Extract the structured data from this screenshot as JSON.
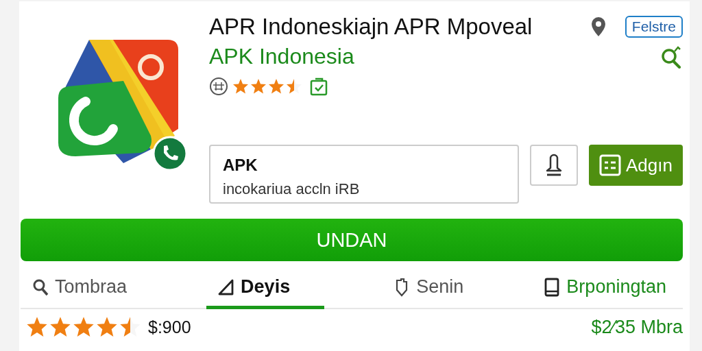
{
  "app": {
    "title": "APR Indoneskiajn APR Mpoveal",
    "developer": "APK Indonesia",
    "stars": 3.5,
    "badge": "Felstre"
  },
  "search": {
    "label": "APK",
    "value": "incokariua accln iRB"
  },
  "action_button": "Adgın",
  "install_button": "UNDAN",
  "tabs": [
    {
      "label": "Tombraa",
      "kind": "search",
      "selected": false,
      "highlighted": false
    },
    {
      "label": "Deyis",
      "kind": "triangle",
      "selected": true,
      "highlighted": false
    },
    {
      "label": "Senin",
      "kind": "tag",
      "selected": false,
      "highlighted": false
    },
    {
      "label": "Brponingtan",
      "kind": "book",
      "selected": false,
      "highlighted": true
    }
  ],
  "summary": {
    "stars": 4.5,
    "price": "$:900",
    "size": "$2⁄35 Mbra"
  }
}
